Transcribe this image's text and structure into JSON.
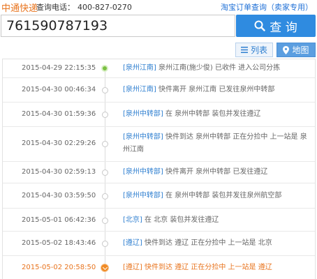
{
  "header": {
    "brand": "中通快递",
    "hotline_label": "查询电话：",
    "hotline_number": "400-827-0270",
    "taobao_link": "淘宝订单查询（卖家专用）"
  },
  "search": {
    "value": "761590787193",
    "button_label": "查 询"
  },
  "view": {
    "list_label": "列表",
    "map_label": "地图"
  },
  "records": [
    {
      "time": "2015-04-29 22:15:35",
      "site": "[泉州江南]",
      "text": " 泉州江南(施少俊) 已收件 进入公司分拣"
    },
    {
      "time": "2015-04-30 00:46:34",
      "site": "[泉州江南]",
      "text": " 快件离开 泉州江南 已发往泉州中转部"
    },
    {
      "time": "2015-04-30 01:59:36",
      "site": "[泉州中转部]",
      "text": " 在 泉州中转部 装包并发往遵辽"
    },
    {
      "time": "2015-04-30 02:29:26",
      "site": "[泉州中转部]",
      "text": " 快件到达 泉州中转部 正在分捡中 上一站是 泉州江南"
    },
    {
      "time": "2015-04-30 02:59:13",
      "site": "[泉州中转部]",
      "text": " 快件离开 泉州中转部 已发往遵辽"
    },
    {
      "time": "2015-04-30 03:59:50",
      "site": "[泉州中转部]",
      "text": " 在 泉州中转部 装包并发往泉州航空部"
    },
    {
      "time": "2015-05-01 06:42:36",
      "site": "[北京]",
      "text": " 在 北京 装包并发往遵辽"
    },
    {
      "time": "2015-05-02 18:43:46",
      "site": "[遵辽]",
      "text": " 快件到达 遵辽 正在分捡中 上一站是 北京"
    },
    {
      "time": "2015-05-02 20:58:50",
      "site": "[遵辽]",
      "text": " 快件到达 遵辽 正在分捡中 上一站是 遵辽"
    }
  ],
  "colors": {
    "brand_orange": "#e8741e",
    "link_blue": "#2f7fd0",
    "search_button": "#2f8be0",
    "first_dot": "#7bc043",
    "latest_dot": "#f08a24"
  }
}
